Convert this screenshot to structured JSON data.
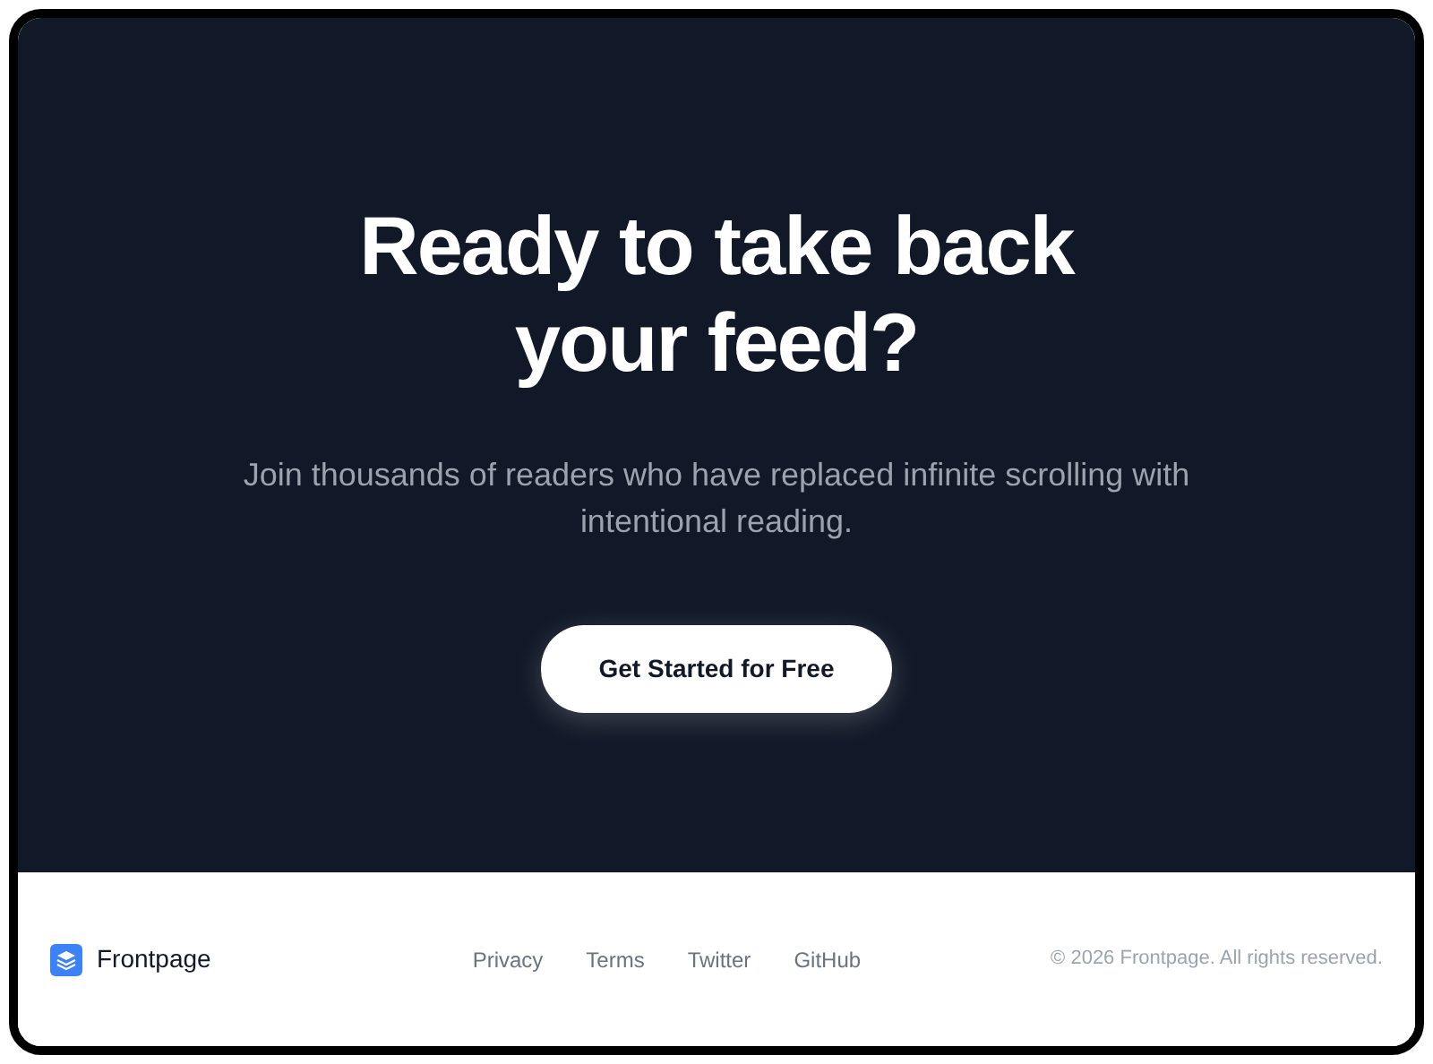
{
  "hero": {
    "title": "Ready to take back your feed?",
    "subtitle": "Join thousands of readers who have replaced infinite scrolling with intentional reading.",
    "cta": "Get Started for Free"
  },
  "footer": {
    "brand": "Frontpage",
    "links": [
      "Privacy",
      "Terms",
      "Twitter",
      "GitHub"
    ],
    "copyright": "© 2026 Frontpage. All rights reserved."
  }
}
